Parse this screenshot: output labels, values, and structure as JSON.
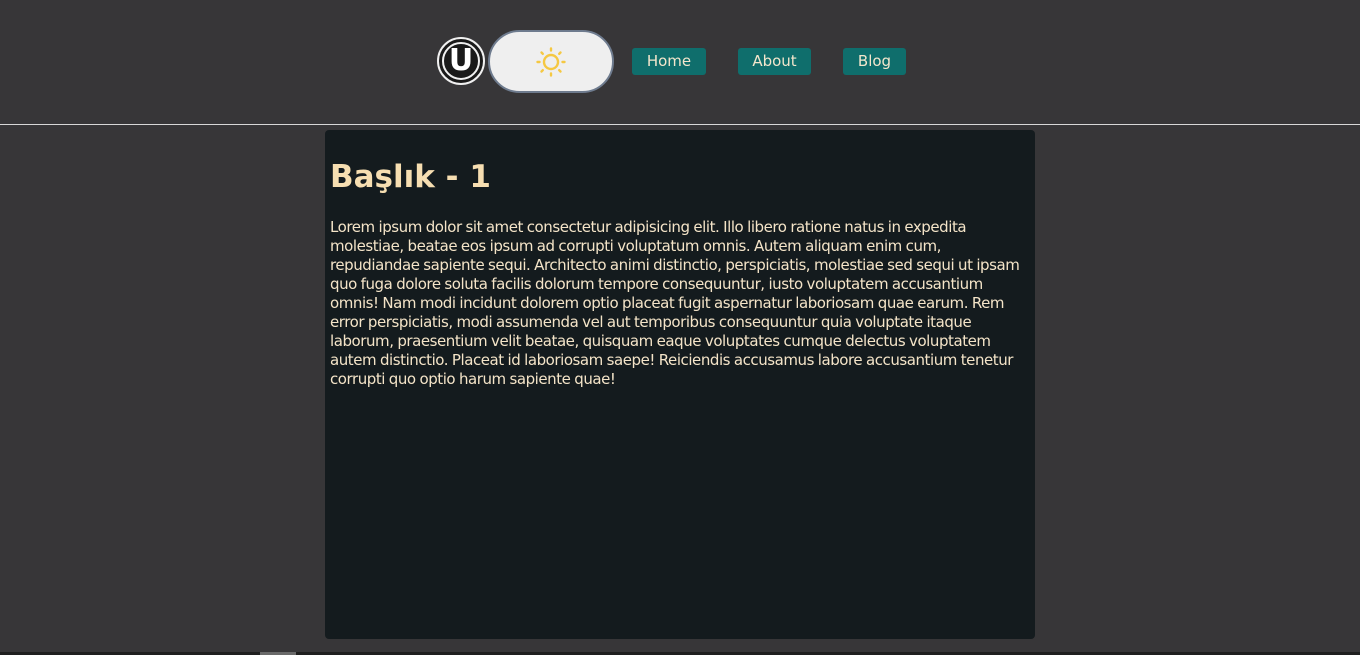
{
  "header": {
    "logo_letter": "U",
    "theme_toggle_icon": "sun-icon",
    "nav": {
      "home_label": "Home",
      "about_label": "About",
      "blog_label": "Blog"
    }
  },
  "main": {
    "title": "Başlık - 1",
    "body": "Lorem ipsum dolor sit amet consectetur adipisicing elit. Illo libero ratione natus in expedita molestiae, beatae eos ipsum ad corrupti voluptatum omnis. Autem aliquam enim cum, repudiandae sapiente sequi. Architecto animi distinctio, perspiciatis, molestiae sed sequi ut ipsam quo fuga dolore soluta facilis dolorum tempore consequuntur, iusto voluptatem accusantium omnis! Nam modi incidunt dolorem optio placeat fugit aspernatur laboriosam quae earum. Rem error perspiciatis, modi assumenda vel aut temporibus consequuntur quia voluptate itaque laborum, praesentium velit beatae, quisquam eaque voluptates cumque delectus voluptatem autem distinctio. Placeat id laboriosam saepe! Reiciendis accusamus labore accusantium tenetur corrupti quo optio harum sapiente quae!"
  },
  "colors": {
    "page_background": "#373638",
    "card_background": "#141b1e",
    "nav_button": "#0f6e6c",
    "title_text": "#f6deb1",
    "body_text": "#f4e4c8",
    "sun": "#f5c842"
  }
}
